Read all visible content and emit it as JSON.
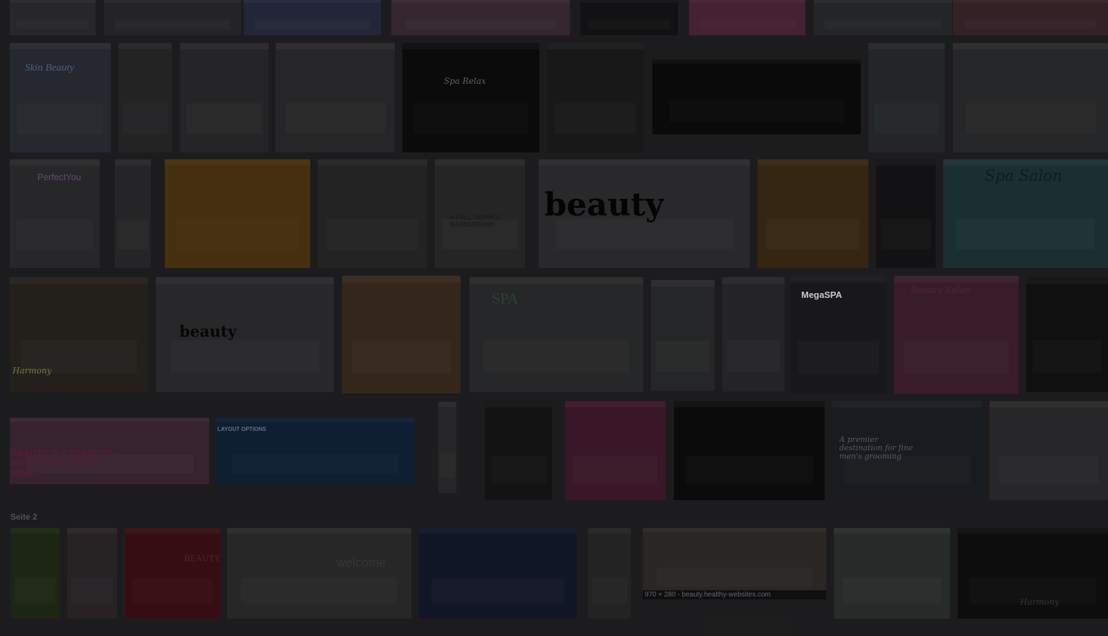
{
  "page_label": "Seite 2",
  "hover_caption": "970 × 280 - beauty.healthy-websites.com",
  "thumbnails": [
    {
      "name": "row0-a",
      "bg": "#2b2b2e",
      "caption": "",
      "cc": "#000"
    },
    {
      "name": "row0-b",
      "bg": "#28282b",
      "caption": "",
      "cc": "#000"
    },
    {
      "name": "row0-c",
      "bg": "#262a3d",
      "caption": "",
      "cc": "#000"
    },
    {
      "name": "row0-d",
      "bg": "#3a2a33",
      "caption": "",
      "cc": "#000"
    },
    {
      "name": "row0-e",
      "bg": "#141416",
      "caption": "",
      "cc": "#000"
    },
    {
      "name": "row0-f",
      "bg": "#4a2438",
      "caption": "",
      "cc": "#000"
    },
    {
      "name": "row0-g",
      "bg": "#27292a",
      "caption": "",
      "cc": "#000"
    },
    {
      "name": "row0-h",
      "bg": "#38242a",
      "caption": "",
      "cc": "#000"
    },
    {
      "name": "skin-beauty",
      "bg": "#2a2c33",
      "caption": "Skin Beauty",
      "cc": "#4b6b8a"
    },
    {
      "name": "row1-b",
      "bg": "#262628",
      "caption": "",
      "cc": "#000"
    },
    {
      "name": "row1-c",
      "bg": "#29292b",
      "caption": "",
      "cc": "#000"
    },
    {
      "name": "row1-d",
      "bg": "#2a2a2c",
      "caption": "",
      "cc": "#000"
    },
    {
      "name": "spa-relax",
      "bg": "#0c0c0d",
      "caption": "Spa Relax",
      "cc": "#6a6a6a"
    },
    {
      "name": "row1-f",
      "bg": "#1b1b1c",
      "caption": "",
      "cc": "#000"
    },
    {
      "name": "hair-banner",
      "bg": "#0b0b0c",
      "caption": "",
      "cc": "#000"
    },
    {
      "name": "row1-h",
      "bg": "#26292a",
      "caption": "",
      "cc": "#000"
    },
    {
      "name": "row1-i",
      "bg": "#2a2b2c",
      "caption": "",
      "cc": "#000"
    },
    {
      "name": "perfect-you",
      "bg": "#2b2b2d",
      "caption": "PerfectYou",
      "cc": "#6b5370"
    },
    {
      "name": "row2-b",
      "bg": "#29292b",
      "caption": "",
      "cc": "#000"
    },
    {
      "name": "row2-c",
      "bg": "#4a3410",
      "caption": "",
      "cc": "#000"
    },
    {
      "name": "row2-d",
      "bg": "#262627",
      "caption": "",
      "cc": "#000"
    },
    {
      "name": "barbershop",
      "bg": "#29292a",
      "caption": "A FULL SERVICE BARBERSHOP",
      "cc": "#1e1e1e"
    },
    {
      "name": "beauty-logo",
      "bg": "#2d2d2f",
      "caption": "beauty",
      "cc": "#050505"
    },
    {
      "name": "row2-g",
      "bg": "#3a2a16",
      "caption": "",
      "cc": "#000"
    },
    {
      "name": "row2-h",
      "bg": "#141416",
      "caption": "",
      "cc": "#000"
    },
    {
      "name": "spa-salon",
      "bg": "#1e3436",
      "caption": "Spa Salon",
      "cc": "#0e2022"
    },
    {
      "name": "harmony",
      "bg": "#26231f",
      "caption": "Harmony",
      "cc": "#7a8a4a"
    },
    {
      "name": "beauty-2",
      "bg": "#2c2c2e",
      "caption": "beauty",
      "cc": "#070707"
    },
    {
      "name": "row3-c",
      "bg": "#3a2a1f",
      "caption": "",
      "cc": "#000"
    },
    {
      "name": "spa-stones",
      "bg": "#2a2b2c",
      "caption": "SPA",
      "cc": "#2e4a3a"
    },
    {
      "name": "row3-e",
      "bg": "#292a2b",
      "caption": "",
      "cc": "#000"
    },
    {
      "name": "row3-f",
      "bg": "#28282a",
      "caption": "",
      "cc": "#000"
    },
    {
      "name": "megaspa",
      "bg": "#1b1b1e",
      "caption": "MegaSPA",
      "cc": "#d8d8e0"
    },
    {
      "name": "beauty-salon",
      "bg": "#3d1f2d",
      "caption": "Beauty Salon",
      "cc": "#5a2a3a"
    },
    {
      "name": "row3-i",
      "bg": "#121213",
      "caption": "",
      "cc": "#000"
    },
    {
      "name": "state-of-mind",
      "bg": "#3c2734",
      "caption": "BEAUTY IS A STATE OF MIND, SIMPLY DON'T MIND.",
      "cc": "#5b1f3c"
    },
    {
      "name": "layout-options",
      "bg": "#0f2236",
      "caption": "LAYOUT OPTIONS",
      "cc": "#6a7f94"
    },
    {
      "name": "row4-c",
      "bg": "#2a2a2c",
      "caption": "",
      "cc": "#000"
    },
    {
      "name": "row4-d",
      "bg": "#151516",
      "caption": "",
      "cc": "#000"
    },
    {
      "name": "row4-e",
      "bg": "#3f1a2c",
      "caption": "",
      "cc": "#000"
    },
    {
      "name": "row4-f",
      "bg": "#0d0d0e",
      "caption": "",
      "cc": "#000"
    },
    {
      "name": "premier-grooming",
      "bg": "#1b1e22",
      "caption": "A premier destination for fine men's grooming",
      "cc": "#5e6266"
    },
    {
      "name": "row4-h",
      "bg": "#2b2b2d",
      "caption": "",
      "cc": "#000"
    },
    {
      "name": "p2-a",
      "bg": "#1f2a14",
      "caption": "",
      "cc": "#000"
    },
    {
      "name": "p2-b",
      "bg": "#2b2528",
      "caption": "",
      "cc": "#000"
    },
    {
      "name": "p2-c",
      "bg": "#3a0f14",
      "caption": "BEAUTY",
      "cc": "#5a2a2a"
    },
    {
      "name": "welcome",
      "bg": "#2c2b2b",
      "caption": "welcome",
      "cc": "#3a3a3a"
    },
    {
      "name": "p2-e",
      "bg": "#13182a",
      "caption": "",
      "cc": "#000"
    },
    {
      "name": "p2-f",
      "bg": "#262627",
      "caption": "",
      "cc": "#000"
    },
    {
      "name": "healthy-websites",
      "bg": "#2d2a27",
      "caption": "",
      "cc": "#000"
    },
    {
      "name": "shop-front",
      "bg": "#2a2f2e",
      "caption": "",
      "cc": "#000"
    },
    {
      "name": "harmony-dark",
      "bg": "#0f0f10",
      "caption": "Harmony",
      "cc": "#3a3a3a"
    }
  ]
}
